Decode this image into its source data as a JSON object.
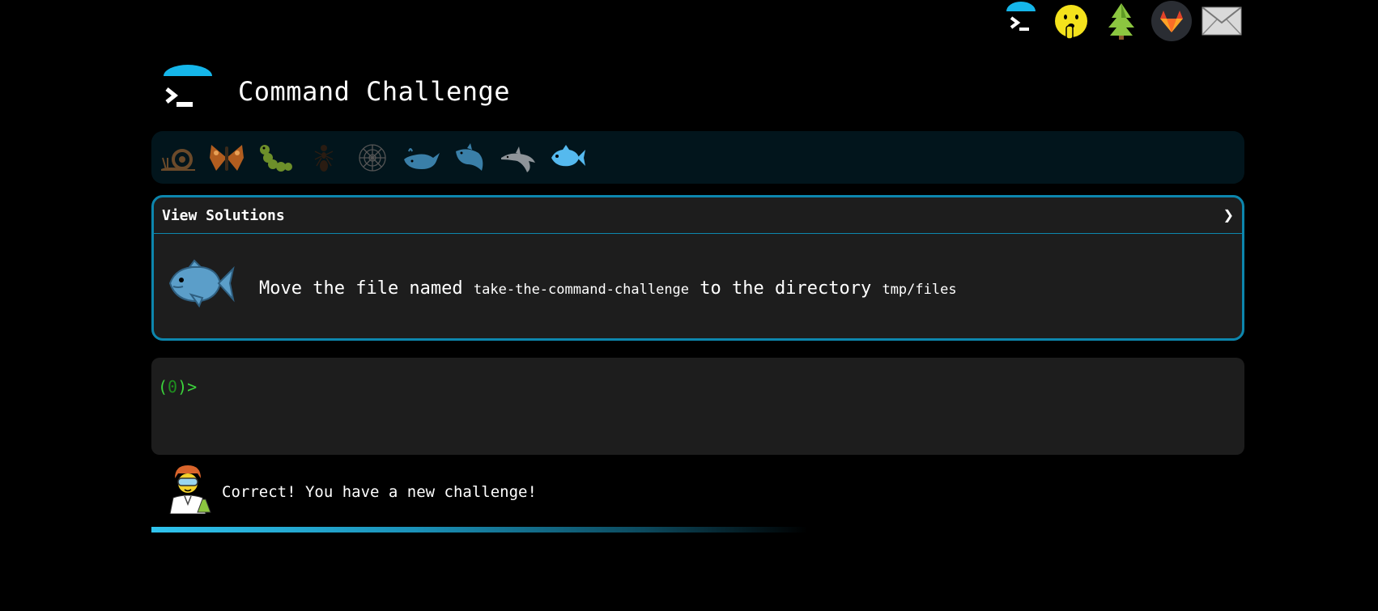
{
  "header": {
    "title": "Command Challenge"
  },
  "top_nav": {
    "icons": [
      "terminal-umbrella-icon",
      "shushing-face-icon",
      "tree-icon",
      "gitlab-icon",
      "mail-icon"
    ]
  },
  "levels": {
    "icons": [
      "snail-icon",
      "butterfly-icon",
      "caterpillar-icon",
      "ant-icon",
      "spider-web-icon",
      "whale-icon",
      "shark-icon",
      "dolphin-icon",
      "fish-icon"
    ],
    "current": "fish-icon"
  },
  "challenge": {
    "header_label": "View Solutions",
    "chevron": "❯",
    "task_prefix": "Move the file named",
    "task_file": "take-the-command-challenge",
    "task_middle": "to the directory",
    "task_dir": "tmp/files"
  },
  "terminal": {
    "prompt_open": "(",
    "prompt_num": "0",
    "prompt_close": ")>"
  },
  "feedback": {
    "message": "Correct! You have a new challenge!"
  },
  "colors": {
    "accent": "#0d86ad",
    "prompt_green": "#3cd43c",
    "progress": "#30c4ee"
  }
}
